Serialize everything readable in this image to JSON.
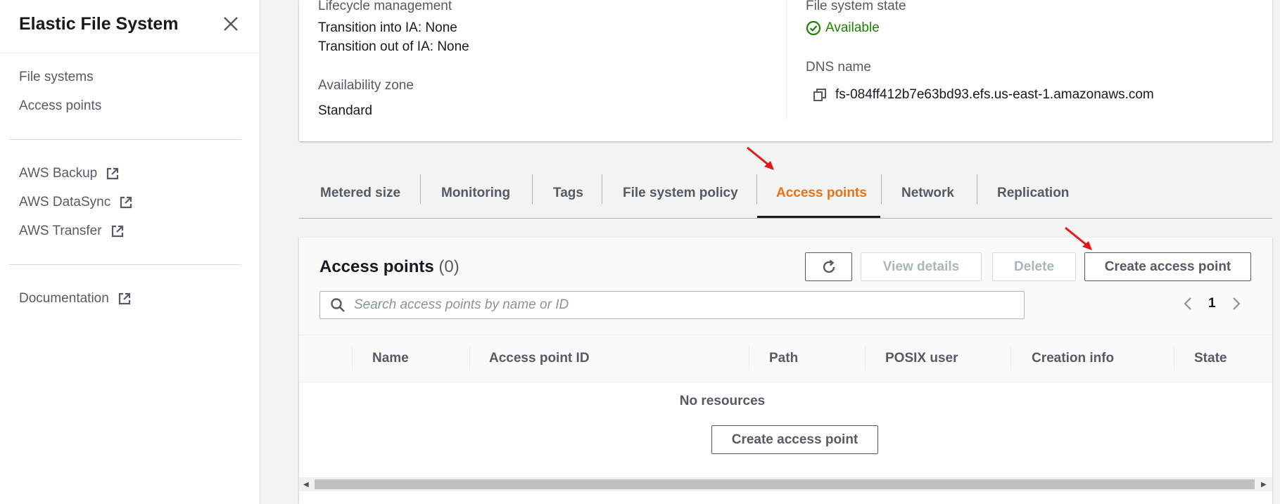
{
  "sidebar": {
    "title": "Elastic File System",
    "links": [
      "File systems",
      "Access points"
    ],
    "external_links": [
      "AWS Backup",
      "AWS DataSync",
      "AWS Transfer"
    ],
    "docs_link": "Documentation"
  },
  "summary": {
    "lifecycle_label": "Lifecycle management",
    "transition_into": "Transition into IA: None",
    "transition_out": "Transition out of IA: None",
    "az_label": "Availability zone",
    "az_value": "Standard",
    "state_label": "File system state",
    "state_value": "Available",
    "dns_label": "DNS name",
    "dns_value": "fs-084ff412b7e63bd93.efs.us-east-1.amazonaws.com"
  },
  "tabs": [
    {
      "label": "Metered size",
      "active": false
    },
    {
      "label": "Monitoring",
      "active": false
    },
    {
      "label": "Tags",
      "active": false
    },
    {
      "label": "File system policy",
      "active": false
    },
    {
      "label": "Access points",
      "active": true
    },
    {
      "label": "Network",
      "active": false
    },
    {
      "label": "Replication",
      "active": false
    }
  ],
  "access_points": {
    "title": "Access points",
    "count": "(0)",
    "view_details": "View details",
    "delete": "Delete",
    "create": "Create access point",
    "search_placeholder": "Search access points by name or ID",
    "page": "1",
    "columns": [
      "Name",
      "Access point ID",
      "Path",
      "POSIX user",
      "Creation info",
      "State"
    ],
    "empty_text": "No resources",
    "empty_create": "Create access point"
  },
  "colors": {
    "accent": "#ec7211",
    "available": "#1d8102",
    "annotation": "#e3161a"
  }
}
